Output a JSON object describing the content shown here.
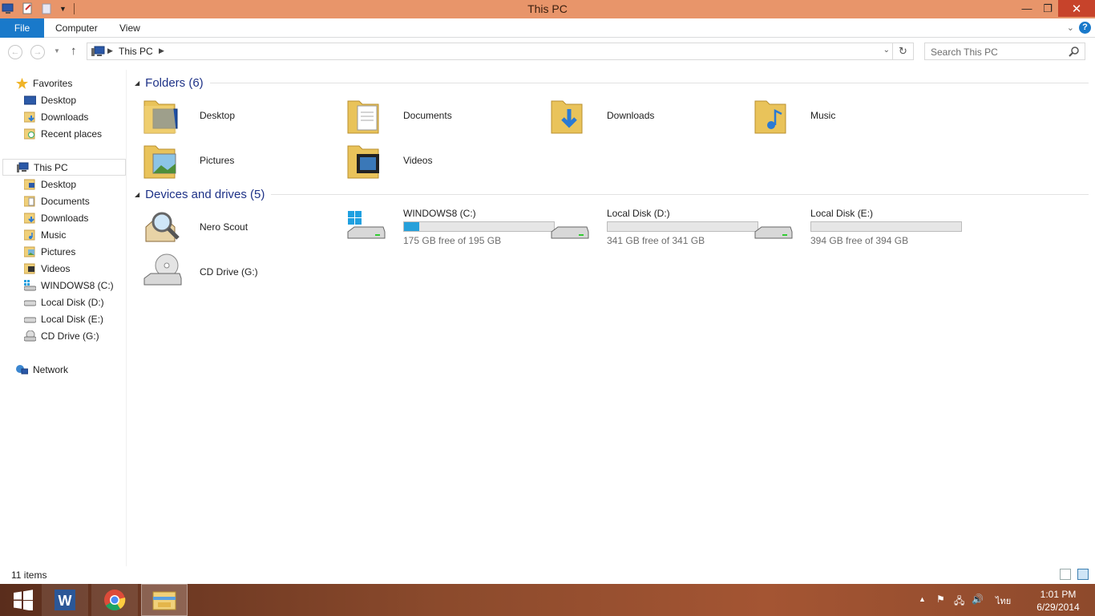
{
  "window": {
    "title": "This PC"
  },
  "ribbon": {
    "tabs": [
      "File",
      "Computer",
      "View"
    ]
  },
  "address": {
    "crumb": "This PC",
    "search_placeholder": "Search This PC"
  },
  "navpane": {
    "favorites": {
      "label": "Favorites",
      "items": [
        "Desktop",
        "Downloads",
        "Recent places"
      ]
    },
    "thispc": {
      "label": "This PC",
      "items": [
        "Desktop",
        "Documents",
        "Downloads",
        "Music",
        "Pictures",
        "Videos",
        "WINDOWS8 (C:)",
        "Local Disk (D:)",
        "Local Disk (E:)",
        "CD Drive (G:)"
      ]
    },
    "network": {
      "label": "Network"
    }
  },
  "content": {
    "folders": {
      "header": "Folders (6)",
      "items": [
        "Desktop",
        "Documents",
        "Downloads",
        "Music",
        "Pictures",
        "Videos"
      ]
    },
    "devices": {
      "header": "Devices and drives (5)",
      "items": [
        {
          "name": "Nero Scout"
        },
        {
          "name": "WINDOWS8 (C:)",
          "free": "175 GB free of 195 GB",
          "used_fraction": 0.1
        },
        {
          "name": "Local Disk (D:)",
          "free": "341 GB free of 341 GB",
          "used_fraction": 0.0
        },
        {
          "name": "Local Disk (E:)",
          "free": "394 GB free of 394 GB",
          "used_fraction": 0.0
        },
        {
          "name": "CD Drive (G:)"
        }
      ]
    }
  },
  "status": {
    "count": "11 items"
  },
  "taskbar": {
    "time": "1:01 PM",
    "date": "6/29/2014",
    "lang": "ไทย"
  },
  "colors": {
    "titlebar": "#e8956a",
    "accent": "#1979ca",
    "group_header": "#1e3287",
    "drive_fill": "#26a0da"
  }
}
